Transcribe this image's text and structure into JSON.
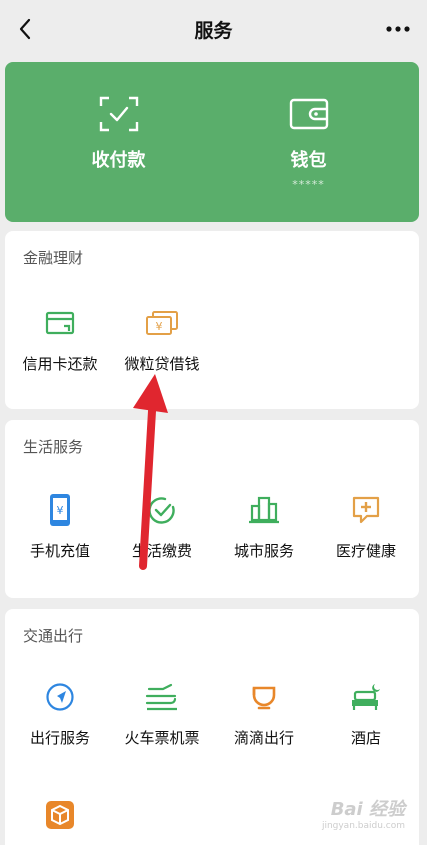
{
  "header": {
    "title": "服务",
    "back_icon": "chevron-left-icon",
    "more_icon": "more-dots-icon"
  },
  "wallet": {
    "pay": {
      "label": "收付款",
      "icon": "scan-pay-icon"
    },
    "wallet": {
      "label": "钱包",
      "sub": "*****",
      "icon": "wallet-icon"
    },
    "accent": "#5aae6b"
  },
  "sections": {
    "finance": {
      "title": "金融理财",
      "items": [
        {
          "label": "信用卡还款",
          "icon": "credit-card-icon"
        },
        {
          "label": "微粒贷借钱",
          "icon": "loan-cash-icon"
        }
      ]
    },
    "life": {
      "title": "生活服务",
      "items": [
        {
          "label": "手机充值",
          "icon": "phone-recharge-icon"
        },
        {
          "label": "生活缴费",
          "icon": "bill-pay-icon"
        },
        {
          "label": "城市服务",
          "icon": "city-service-icon"
        },
        {
          "label": "医疗健康",
          "icon": "medical-icon"
        }
      ]
    },
    "transport": {
      "title": "交通出行",
      "items": [
        {
          "label": "出行服务",
          "icon": "travel-icon"
        },
        {
          "label": "火车票机票",
          "icon": "train-plane-icon"
        },
        {
          "label": "滴滴出行",
          "icon": "didi-icon"
        },
        {
          "label": "酒店",
          "icon": "hotel-icon"
        },
        {
          "label": "",
          "icon": "package-icon"
        }
      ]
    }
  },
  "annotation": {
    "color": "#e0262f"
  },
  "watermark": {
    "main": "Bai 经验",
    "sub": "jingyan.baidu.com"
  }
}
